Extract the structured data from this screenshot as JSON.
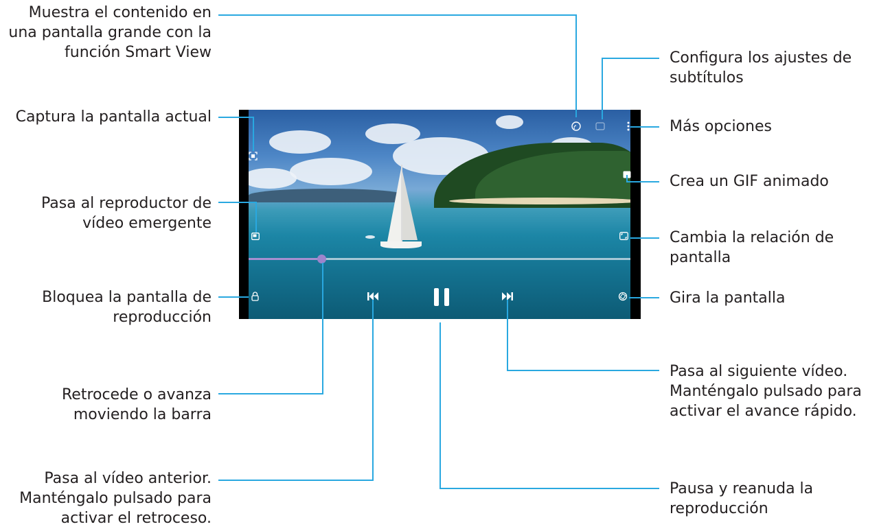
{
  "callouts": {
    "smart_view": [
      "Muestra el contenido en",
      "una pantalla grande con la",
      "función Smart View"
    ],
    "capture": [
      "Captura la pantalla actual"
    ],
    "popup_player": [
      "Pasa al reproductor de",
      "vídeo emergente"
    ],
    "lock": [
      "Bloquea la pantalla de",
      "reproducción"
    ],
    "seek": [
      "Retrocede o avanza",
      "moviendo la barra"
    ],
    "previous": [
      "Pasa al vídeo anterior.",
      "Manténgalo pulsado para",
      "activar el retroceso."
    ],
    "subtitles": [
      "Configura los ajustes de",
      "subtítulos"
    ],
    "more": [
      "Más opciones"
    ],
    "gif": [
      "Crea un GIF animado"
    ],
    "ratio": [
      "Cambia la relación de",
      "pantalla"
    ],
    "rotate": [
      "Gira la pantalla"
    ],
    "next": [
      "Pasa al siguiente vídeo.",
      "Manténgalo pulsado para",
      "activar el avance rápido."
    ],
    "pause": [
      "Pausa y reanuda la",
      "reproducción"
    ]
  },
  "player": {
    "progress": 0.19,
    "accent": "#29a8e0",
    "seek_color": "#9d85cc",
    "icons": [
      "smart-view-icon",
      "subtitles-icon",
      "more-options-icon",
      "capture-icon",
      "gif-icon",
      "popup-player-icon",
      "aspect-ratio-icon",
      "lock-icon",
      "rotate-icon",
      "previous-icon",
      "pause-icon",
      "next-icon"
    ]
  }
}
